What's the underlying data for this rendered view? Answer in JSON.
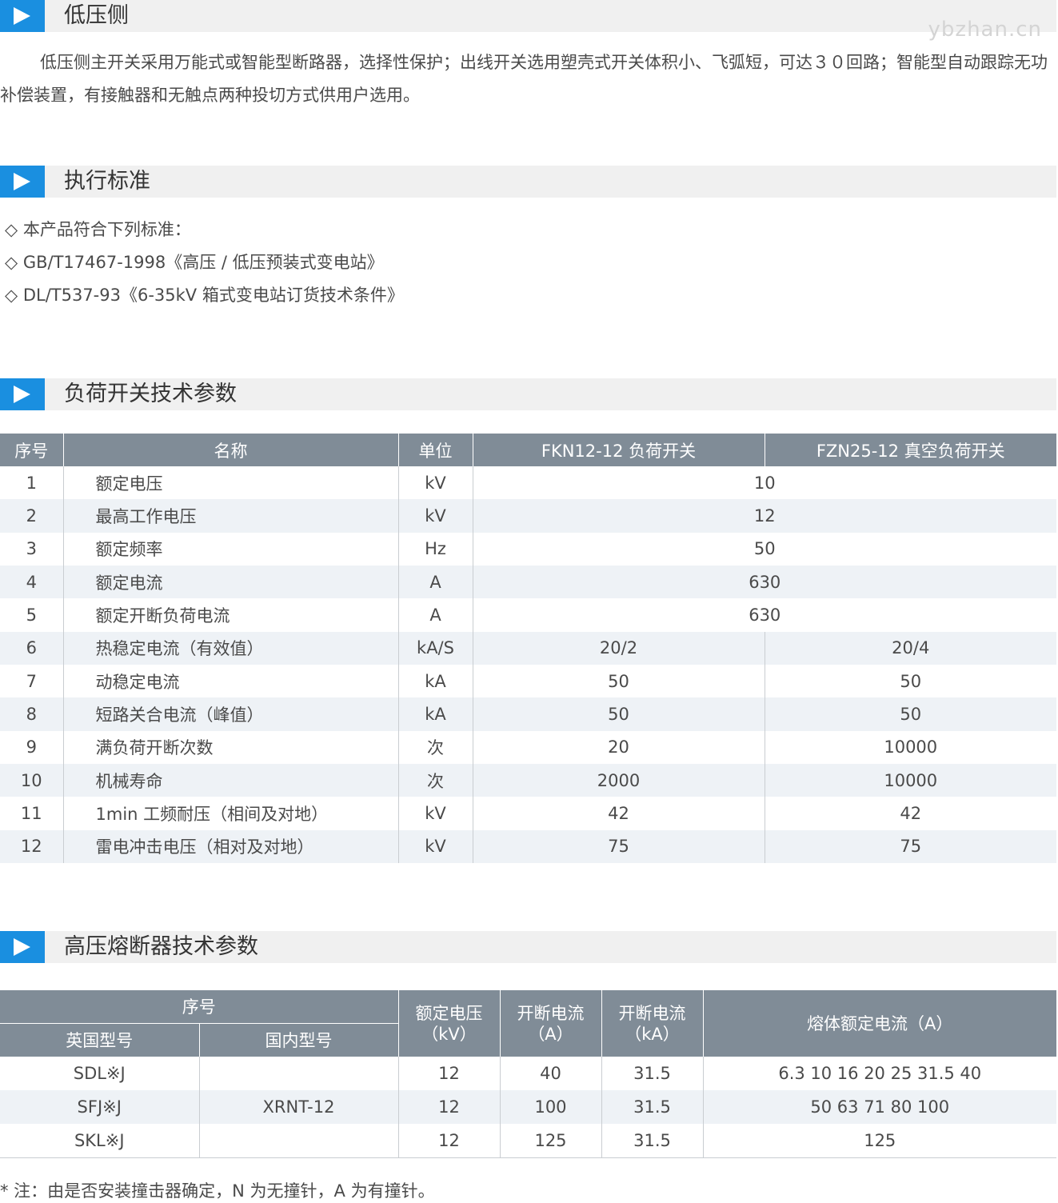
{
  "sections": {
    "low_voltage": {
      "title": "低压侧",
      "text": "低压侧主开关采用万能式或智能型断路器，选择性保护；出线开关选用塑壳式开关体积小、飞弧短，可达３０回路；智能型自动跟踪无功补偿装置，有接触器和无触点两种投切方式供用户选用。"
    },
    "standards": {
      "title": "执行标准",
      "items": [
        "◇ 本产品符合下列标准：",
        "◇ GB/T17467-1998《高压 / 低压预装式变电站》",
        "◇ DL/T537-93《6-35kV 箱式变电站订货技术条件》"
      ]
    },
    "load_switch": {
      "title": "负荷开关技术参数",
      "headers": [
        "序号",
        "名称",
        "单位",
        "FKN12-12 负荷开关",
        "FZN25-12 真空负荷开关"
      ],
      "rows": [
        {
          "no": "1",
          "name": "额定电压",
          "unit": "kV",
          "merged": "10"
        },
        {
          "no": "2",
          "name": "最高工作电压",
          "unit": "kV",
          "merged": "12"
        },
        {
          "no": "3",
          "name": "额定频率",
          "unit": "Hz",
          "merged": "50"
        },
        {
          "no": "4",
          "name": "额定电流",
          "unit": "A",
          "merged": "630"
        },
        {
          "no": "5",
          "name": "额定开断负荷电流",
          "unit": "A",
          "merged": "630"
        },
        {
          "no": "6",
          "name": "热稳定电流（有效值）",
          "unit": "kA/S",
          "fkn": "20/2",
          "fzn": "20/4"
        },
        {
          "no": "7",
          "name": "动稳定电流",
          "unit": "kA",
          "fkn": "50",
          "fzn": "50"
        },
        {
          "no": "8",
          "name": "短路关合电流（峰值）",
          "unit": "kA",
          "fkn": "50",
          "fzn": "50"
        },
        {
          "no": "9",
          "name": "满负荷开断次数",
          "unit": "次",
          "fkn": "20",
          "fzn": "10000"
        },
        {
          "no": "10",
          "name": "机械寿命",
          "unit": "次",
          "fkn": "2000",
          "fzn": "10000"
        },
        {
          "no": "11",
          "name": "1min 工频耐压（相间及对地）",
          "unit": "kV",
          "fkn": "42",
          "fzn": "42"
        },
        {
          "no": "12",
          "name": "雷电冲击电压（相对及对地）",
          "unit": "kV",
          "fkn": "75",
          "fzn": "75"
        }
      ]
    },
    "fuse": {
      "title": "高压熔断器技术参数",
      "headers": {
        "serial": "序号",
        "uk_model": "英国型号",
        "cn_model": "国内型号",
        "voltage_l1": "额定电压",
        "voltage_l2": "（kV）",
        "break_current_l1": "开断电流",
        "break_current_l2": "（A）",
        "break_ka_l1": "开断电流",
        "break_ka_l2": "（kA）",
        "melt_current": "熔体额定电流（A）"
      },
      "rows": [
        {
          "uk": "SDL※J",
          "voltage": "12",
          "amp": "40",
          "ka": "31.5",
          "melt": "6.3 10 16 20 25 31.5 40"
        },
        {
          "uk": "SFJ※J",
          "voltage": "12",
          "amp": "100",
          "ka": "31.5",
          "melt": "50 63 71 80 100"
        },
        {
          "uk": "SKL※J",
          "voltage": "12",
          "amp": "125",
          "ka": "31.5",
          "melt": "125"
        }
      ],
      "cn_model_value": "XRNT-12"
    }
  },
  "note": "* 注：由是否安装撞击器确定，N 为无撞针，A 为有撞针。",
  "watermark": "ybzhan.cn",
  "colors": {
    "accent": "#1a8fe0",
    "header_bg": "#808c97",
    "section_bg": "#f0f0f0",
    "stripe": "#eef2f6"
  }
}
